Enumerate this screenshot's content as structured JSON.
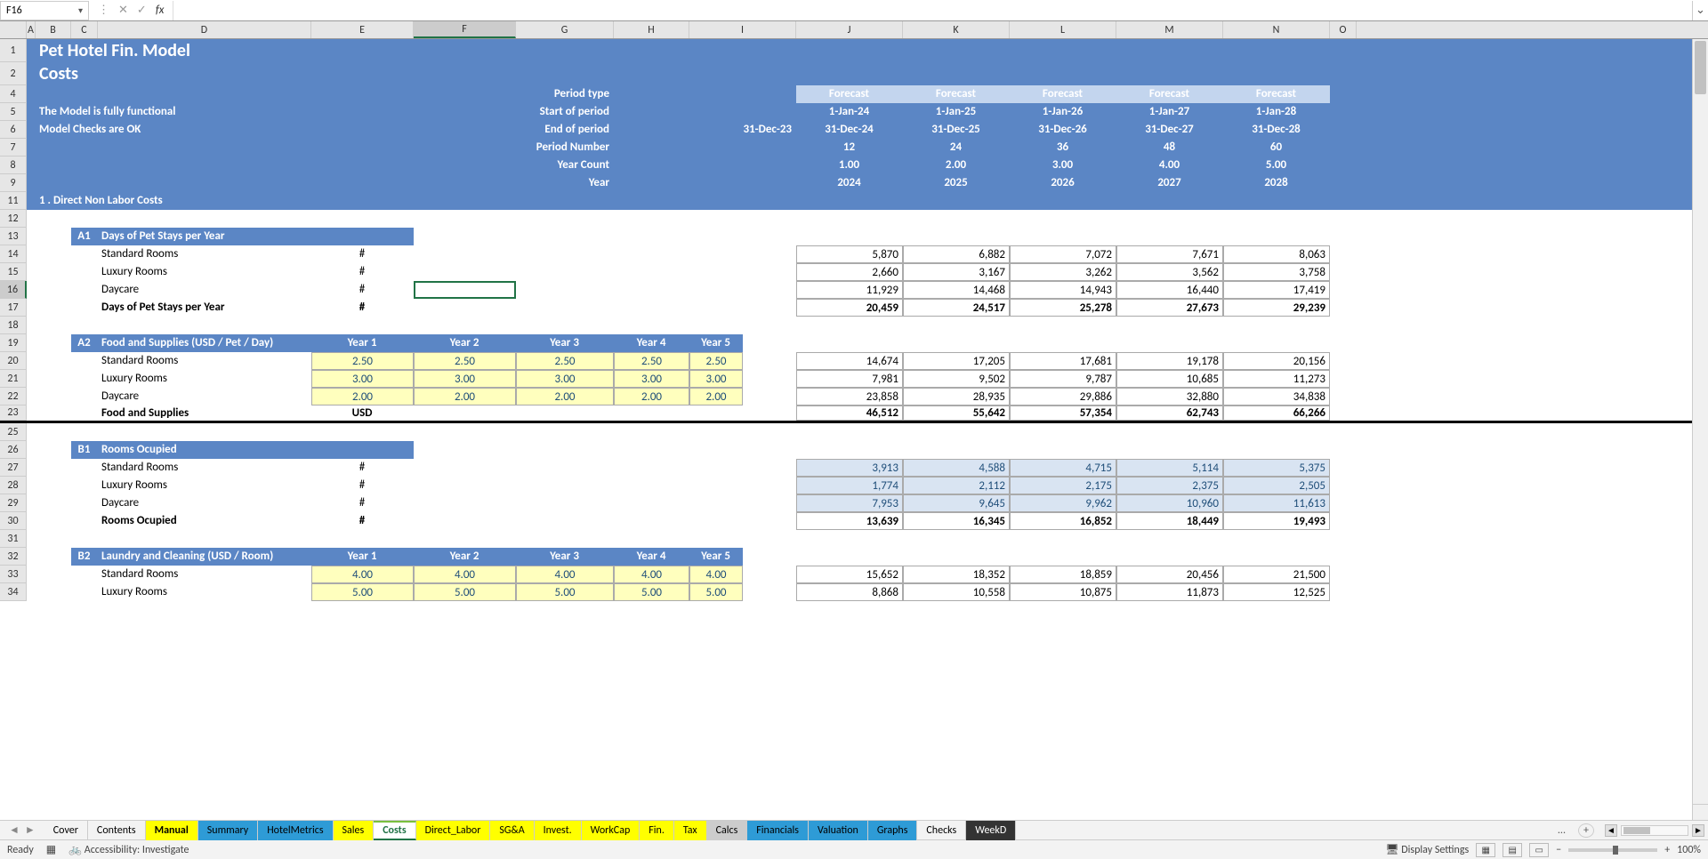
{
  "nameBox": "F16",
  "fx": "fx",
  "columns": [
    "A",
    "B",
    "C",
    "D",
    "E",
    "F",
    "G",
    "H",
    "I",
    "J",
    "K",
    "L",
    "M",
    "N",
    "O"
  ],
  "activeCol": "F",
  "activeRow": "16",
  "header": {
    "title": "Pet Hotel Fin. Model",
    "subtitle": "Costs",
    "note1": "The Model is fully functional",
    "note2": "Model Checks are OK",
    "labels": {
      "periodType": "Period type",
      "startOfPeriod": "Start of period",
      "endOfPeriod": "End of period",
      "periodNumber": "Period Number",
      "yearCount": "Year Count",
      "year": "Year"
    },
    "forecast": "Forecast",
    "endPrev": "31-Dec-23",
    "cols": {
      "start": [
        "1-Jan-24",
        "1-Jan-25",
        "1-Jan-26",
        "1-Jan-27",
        "1-Jan-28"
      ],
      "end": [
        "31-Dec-24",
        "31-Dec-25",
        "31-Dec-26",
        "31-Dec-27",
        "31-Dec-28"
      ],
      "pnum": [
        "12",
        "24",
        "36",
        "48",
        "60"
      ],
      "ycount": [
        "1.00",
        "2.00",
        "3.00",
        "4.00",
        "5.00"
      ],
      "year": [
        "2024",
        "2025",
        "2026",
        "2027",
        "2028"
      ]
    }
  },
  "section1": "1 . Direct Non Labor Costs",
  "a1": {
    "code": "A1",
    "title": "Days of Pet Stays per Year",
    "rows": [
      {
        "label": "Standard Rooms",
        "unit": "#",
        "vals": [
          "5,870",
          "6,882",
          "7,072",
          "7,671",
          "8,063"
        ]
      },
      {
        "label": "Luxury Rooms",
        "unit": "#",
        "vals": [
          "2,660",
          "3,167",
          "3,262",
          "3,562",
          "3,758"
        ]
      },
      {
        "label": "Daycare",
        "unit": "#",
        "vals": [
          "11,929",
          "14,468",
          "14,943",
          "16,440",
          "17,419"
        ]
      }
    ],
    "totalLabel": "Days of Pet Stays per Year",
    "totalUnit": "#",
    "totals": [
      "20,459",
      "24,517",
      "25,278",
      "27,673",
      "29,239"
    ]
  },
  "a2": {
    "code": "A2",
    "title": "Food and Supplies (USD / Pet / Day)",
    "yheads": [
      "Year 1",
      "Year 2",
      "Year 3",
      "Year 4",
      "Year 5"
    ],
    "rows": [
      {
        "label": "Standard Rooms",
        "inputs": [
          "2.50",
          "2.50",
          "2.50",
          "2.50",
          "2.50"
        ],
        "vals": [
          "14,674",
          "17,205",
          "17,681",
          "19,178",
          "20,156"
        ]
      },
      {
        "label": "Luxury Rooms",
        "inputs": [
          "3.00",
          "3.00",
          "3.00",
          "3.00",
          "3.00"
        ],
        "vals": [
          "7,981",
          "9,502",
          "9,787",
          "10,685",
          "11,273"
        ]
      },
      {
        "label": "Daycare",
        "inputs": [
          "2.00",
          "2.00",
          "2.00",
          "2.00",
          "2.00"
        ],
        "vals": [
          "23,858",
          "28,935",
          "29,886",
          "32,880",
          "34,838"
        ]
      }
    ],
    "totalLabel": "Food and Supplies",
    "totalUnit": "USD",
    "totals": [
      "46,512",
      "55,642",
      "57,354",
      "62,743",
      "66,266"
    ]
  },
  "b1": {
    "code": "B1",
    "title": "Rooms Ocupied",
    "rows": [
      {
        "label": "Standard Rooms",
        "unit": "#",
        "vals": [
          "3,913",
          "4,588",
          "4,715",
          "5,114",
          "5,375"
        ]
      },
      {
        "label": "Luxury Rooms",
        "unit": "#",
        "vals": [
          "1,774",
          "2,112",
          "2,175",
          "2,375",
          "2,505"
        ]
      },
      {
        "label": "Daycare",
        "unit": "#",
        "vals": [
          "7,953",
          "9,645",
          "9,962",
          "10,960",
          "11,613"
        ]
      }
    ],
    "totalLabel": "Rooms Ocupied",
    "totalUnit": "#",
    "totals": [
      "13,639",
      "16,345",
      "16,852",
      "18,449",
      "19,493"
    ]
  },
  "b2": {
    "code": "B2",
    "title": "Laundry and Cleaning (USD / Room)",
    "yheads": [
      "Year 1",
      "Year 2",
      "Year 3",
      "Year 4",
      "Year 5"
    ],
    "rows": [
      {
        "label": "Standard Rooms",
        "inputs": [
          "4.00",
          "4.00",
          "4.00",
          "4.00",
          "4.00"
        ],
        "vals": [
          "15,652",
          "18,352",
          "18,859",
          "20,456",
          "21,500"
        ]
      },
      {
        "label": "Luxury Rooms",
        "inputs": [
          "5.00",
          "5.00",
          "5.00",
          "5.00",
          "5.00"
        ],
        "vals": [
          "8,868",
          "10,558",
          "10,875",
          "11,873",
          "12,525"
        ]
      }
    ]
  },
  "tabs": [
    {
      "label": "Cover",
      "cls": ""
    },
    {
      "label": "Contents",
      "cls": ""
    },
    {
      "label": "Manual",
      "cls": "c-yellow bold"
    },
    {
      "label": "Summary",
      "cls": "c-blue"
    },
    {
      "label": "HotelMetrics",
      "cls": "c-blue"
    },
    {
      "label": "Sales",
      "cls": "c-yellow"
    },
    {
      "label": "Costs",
      "cls": "active c-green"
    },
    {
      "label": "Direct_Labor",
      "cls": "c-yellow"
    },
    {
      "label": "SG&A",
      "cls": "c-yellow"
    },
    {
      "label": "Invest.",
      "cls": "c-yellow"
    },
    {
      "label": "WorkCap",
      "cls": "c-yellow"
    },
    {
      "label": "Fin.",
      "cls": "c-yellow"
    },
    {
      "label": "Tax",
      "cls": "c-yellow"
    },
    {
      "label": "Calcs",
      "cls": "c-ccc"
    },
    {
      "label": "Financials",
      "cls": "c-blue"
    },
    {
      "label": "Valuation",
      "cls": "c-blue"
    },
    {
      "label": "Graphs",
      "cls": "c-blue"
    },
    {
      "label": "Checks",
      "cls": ""
    },
    {
      "label": "WeekD",
      "cls": "c-dark"
    }
  ],
  "tabEllipsis": "...",
  "status": {
    "ready": "Ready",
    "accessibility": "Accessibility: Investigate",
    "displaySettings": "Display Settings",
    "zoom": "100%"
  },
  "rowNums": [
    "1",
    "2",
    "4",
    "5",
    "6",
    "7",
    "8",
    "9",
    "11",
    "12",
    "13",
    "14",
    "15",
    "16",
    "17",
    "18",
    "19",
    "20",
    "21",
    "22",
    "23",
    "25",
    "26",
    "27",
    "28",
    "29",
    "30",
    "31",
    "32",
    "33",
    "34"
  ]
}
